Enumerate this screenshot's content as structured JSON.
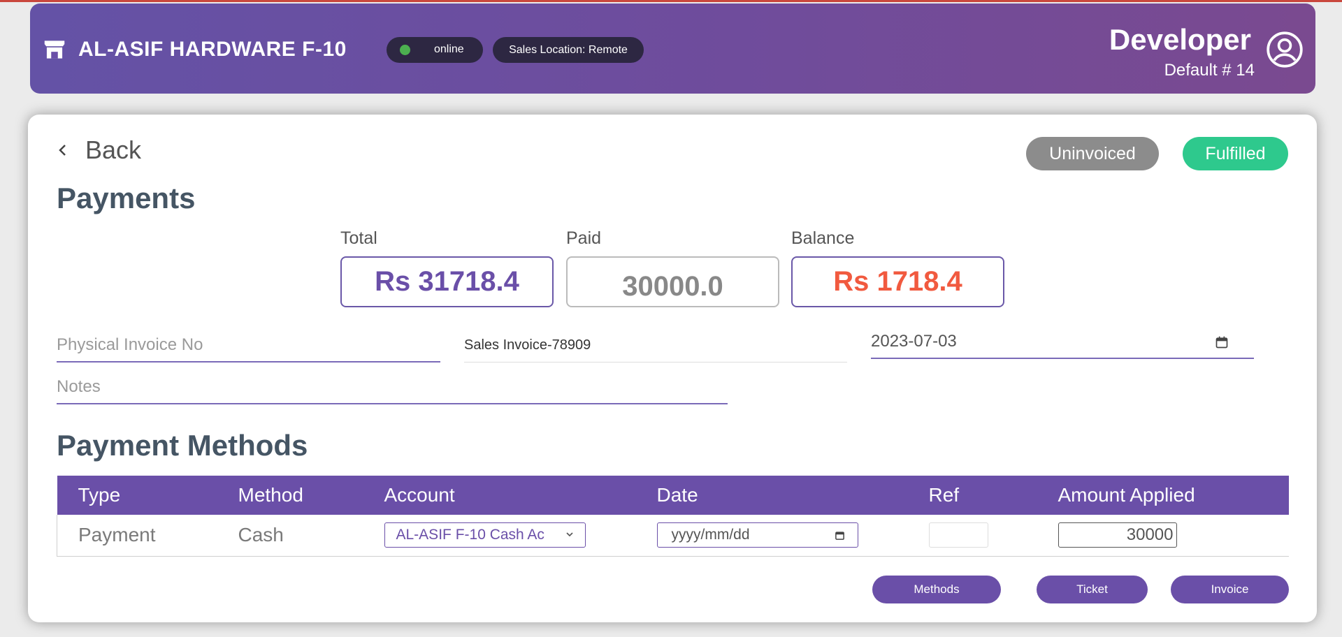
{
  "header": {
    "store_name": "AL-ASIF HARDWARE F-10",
    "status": "online",
    "location": "Sales Location: Remote",
    "user_name": "Developer",
    "user_sub": "Default # 14"
  },
  "page": {
    "back_label": "Back",
    "status_badges": [
      "Uninvoiced",
      "Fulfilled"
    ],
    "title": "Payments"
  },
  "summary": {
    "total_label": "Total",
    "total_value": "Rs 31718.4",
    "paid_label": "Paid",
    "paid_value": "30000.0",
    "balance_label": "Balance",
    "balance_value": "Rs 1718.4"
  },
  "form": {
    "physical_invoice_placeholder": "Physical Invoice No",
    "sales_invoice": "Sales Invoice-78909",
    "date": "2023-07-03",
    "notes_placeholder": "Notes"
  },
  "methods": {
    "title": "Payment Methods",
    "columns": [
      "Type",
      "Method",
      "Account",
      "Date",
      "Ref",
      "Amount Applied"
    ],
    "rows": [
      {
        "type": "Payment",
        "method": "Cash",
        "account": "AL-ASIF F-10 Cash Ac",
        "date_placeholder": "yyyy/mm/dd",
        "ref": "",
        "amount": "30000"
      }
    ]
  },
  "actions": {
    "methods": "Methods",
    "ticket": "Ticket",
    "invoice": "Invoice"
  },
  "colors": {
    "accent": "#6a4fa8",
    "balance": "#f15a3f",
    "fulfilled": "#2ec98d",
    "uninvoiced": "#8c8c8c",
    "online": "#4caf50"
  }
}
